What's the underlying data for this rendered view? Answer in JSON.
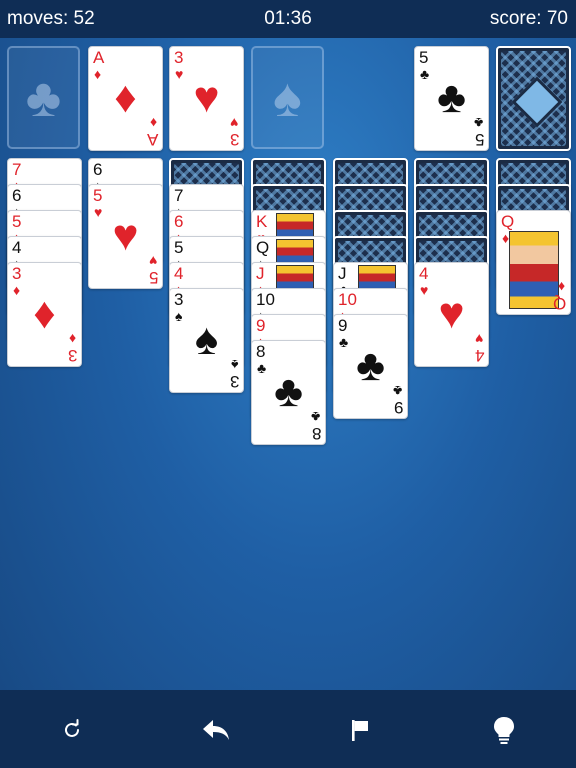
{
  "status": {
    "moves": "moves: 52",
    "time": "01:36",
    "score": "score: 70"
  },
  "foundations": [
    {
      "type": "empty",
      "icon": "♣",
      "icon_name": "club-icon"
    },
    {
      "type": "card",
      "rank": "A",
      "suit": "♦",
      "color": "red"
    },
    {
      "type": "card",
      "rank": "3",
      "suit": "♥",
      "color": "red"
    },
    {
      "type": "empty",
      "icon": "♠",
      "icon_name": "spade-icon"
    }
  ],
  "waste": {
    "rank": "5",
    "suit": "♣",
    "color": "black"
  },
  "stock": {
    "type": "back"
  },
  "tableau": [
    {
      "hidden": 0,
      "cards": [
        {
          "rank": "7",
          "suit": "♦",
          "color": "red"
        },
        {
          "rank": "6",
          "suit": "♠",
          "color": "black"
        },
        {
          "rank": "5",
          "suit": "♦",
          "color": "red"
        },
        {
          "rank": "4",
          "suit": "♠",
          "color": "black"
        },
        {
          "rank": "3",
          "suit": "♦",
          "color": "red"
        }
      ]
    },
    {
      "hidden": 0,
      "cards": [
        {
          "rank": "6",
          "suit": "♠",
          "color": "black"
        },
        {
          "rank": "5",
          "suit": "♥",
          "color": "red"
        }
      ]
    },
    {
      "hidden": 1,
      "cards": [
        {
          "rank": "7",
          "suit": "♠",
          "color": "black"
        },
        {
          "rank": "6",
          "suit": "♦",
          "color": "red"
        },
        {
          "rank": "5",
          "suit": "♠",
          "color": "black"
        },
        {
          "rank": "4",
          "suit": "♦",
          "color": "red"
        },
        {
          "rank": "3",
          "suit": "♠",
          "color": "black"
        }
      ]
    },
    {
      "hidden": 2,
      "cards": [
        {
          "rank": "K",
          "suit": "♥",
          "color": "red",
          "face": true
        },
        {
          "rank": "Q",
          "suit": "♠",
          "color": "black",
          "face": true
        },
        {
          "rank": "J",
          "suit": "♦",
          "color": "red",
          "face": true
        },
        {
          "rank": "10",
          "suit": "♠",
          "color": "black"
        },
        {
          "rank": "9",
          "suit": "♦",
          "color": "red"
        },
        {
          "rank": "8",
          "suit": "♣",
          "color": "black"
        }
      ]
    },
    {
      "hidden": 4,
      "cards": [
        {
          "rank": "J",
          "suit": "♣",
          "color": "black",
          "face": true
        },
        {
          "rank": "10",
          "suit": "♦",
          "color": "red"
        },
        {
          "rank": "9",
          "suit": "♣",
          "color": "black"
        }
      ]
    },
    {
      "hidden": 4,
      "cards": [
        {
          "rank": "4",
          "suit": "♥",
          "color": "red"
        }
      ]
    },
    {
      "hidden": 2,
      "cards": [
        {
          "rank": "Q",
          "suit": "♦",
          "color": "red",
          "face": true
        }
      ]
    }
  ],
  "toolbar": [
    {
      "name": "new-game-button",
      "icon_name": "restart-icon"
    },
    {
      "name": "undo-button",
      "icon_name": "undo-icon"
    },
    {
      "name": "flag-button",
      "icon_name": "flag-icon"
    },
    {
      "name": "hint-button",
      "icon_name": "lightbulb-icon"
    }
  ]
}
